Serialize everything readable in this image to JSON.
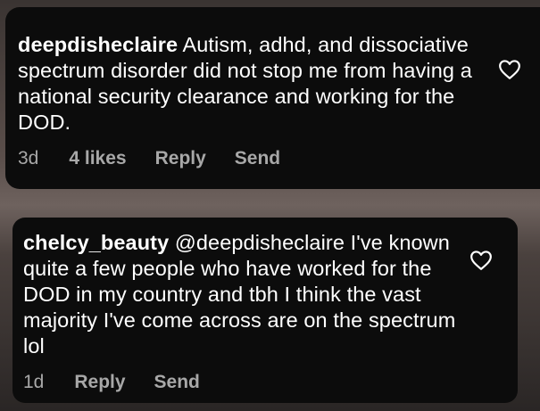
{
  "comments": [
    {
      "username": "deepdisheclaire",
      "text": "Autism, adhd, and dissociative spectrum disorder did not stop me from having a national security clearance and working for the DOD.",
      "time": "3d",
      "likes": "4 likes",
      "reply_label": "Reply",
      "send_label": "Send",
      "like_icon": "heart-outline-icon"
    },
    {
      "username": "chelcy_beauty",
      "text": "@deepdisheclaire I've known quite a few people who have worked for the DOD in my country and tbh I think the vast majority I've come across are on the spectrum lol",
      "time": "1d",
      "reply_label": "Reply",
      "send_label": "Send",
      "like_icon": "heart-outline-icon"
    }
  ],
  "colors": {
    "card_bg": "#0c0c0c",
    "text": "#ffffff",
    "meta_text": "#a8a8a8"
  }
}
